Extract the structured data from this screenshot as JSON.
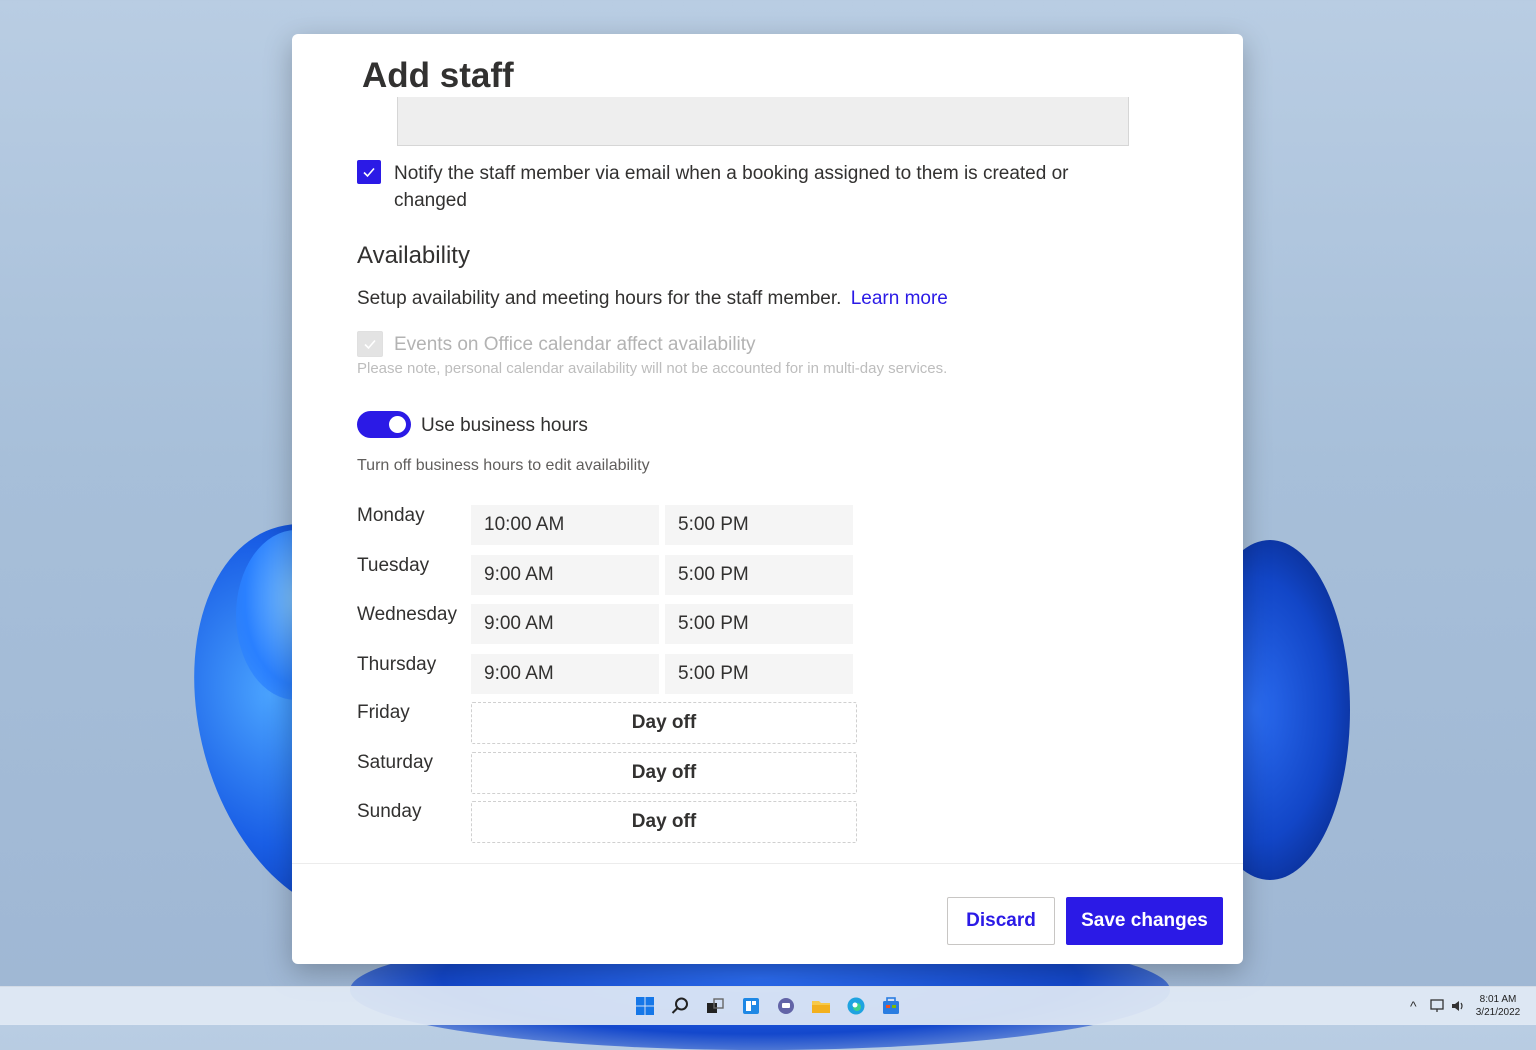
{
  "dialog": {
    "title": "Add staff",
    "notify_label": "Notify the staff member via email when a booking assigned to them is created or changed",
    "notify_checked": true
  },
  "availability": {
    "heading": "Availability",
    "description": "Setup availability and meeting hours for the staff member.",
    "learn_more": "Learn more",
    "events_label": "Events on Office calendar affect availability",
    "events_checked": true,
    "events_disabled": true,
    "note": "Please note, personal calendar availability will not be accounted for in multi-day services.",
    "business_hours_label": "Use business hours",
    "business_hours_on": true,
    "turn_off_hint": "Turn off business hours to edit availability",
    "days": [
      {
        "day": "Monday",
        "start": "10:00 AM",
        "end": "5:00 PM"
      },
      {
        "day": "Tuesday",
        "start": "9:00 AM",
        "end": "5:00 PM"
      },
      {
        "day": "Wednesday",
        "start": "9:00 AM",
        "end": "5:00 PM"
      },
      {
        "day": "Thursday",
        "start": "9:00 AM",
        "end": "5:00 PM"
      },
      {
        "day": "Friday",
        "off": "Day off"
      },
      {
        "day": "Saturday",
        "off": "Day off"
      },
      {
        "day": "Sunday",
        "off": "Day off"
      }
    ]
  },
  "footer": {
    "discard": "Discard",
    "save": "Save changes"
  },
  "taskbar": {
    "time": "8:01 AM",
    "date": "3/21/2022",
    "icons": [
      "windows-start-icon",
      "search-icon",
      "task-view-icon",
      "widgets-icon",
      "teams-chat-icon",
      "file-explorer-icon",
      "edge-browser-icon",
      "store-icon"
    ]
  },
  "colors": {
    "accent": "#2b1ae6",
    "text": "#323130",
    "disabled_text": "#b3b3b3"
  }
}
